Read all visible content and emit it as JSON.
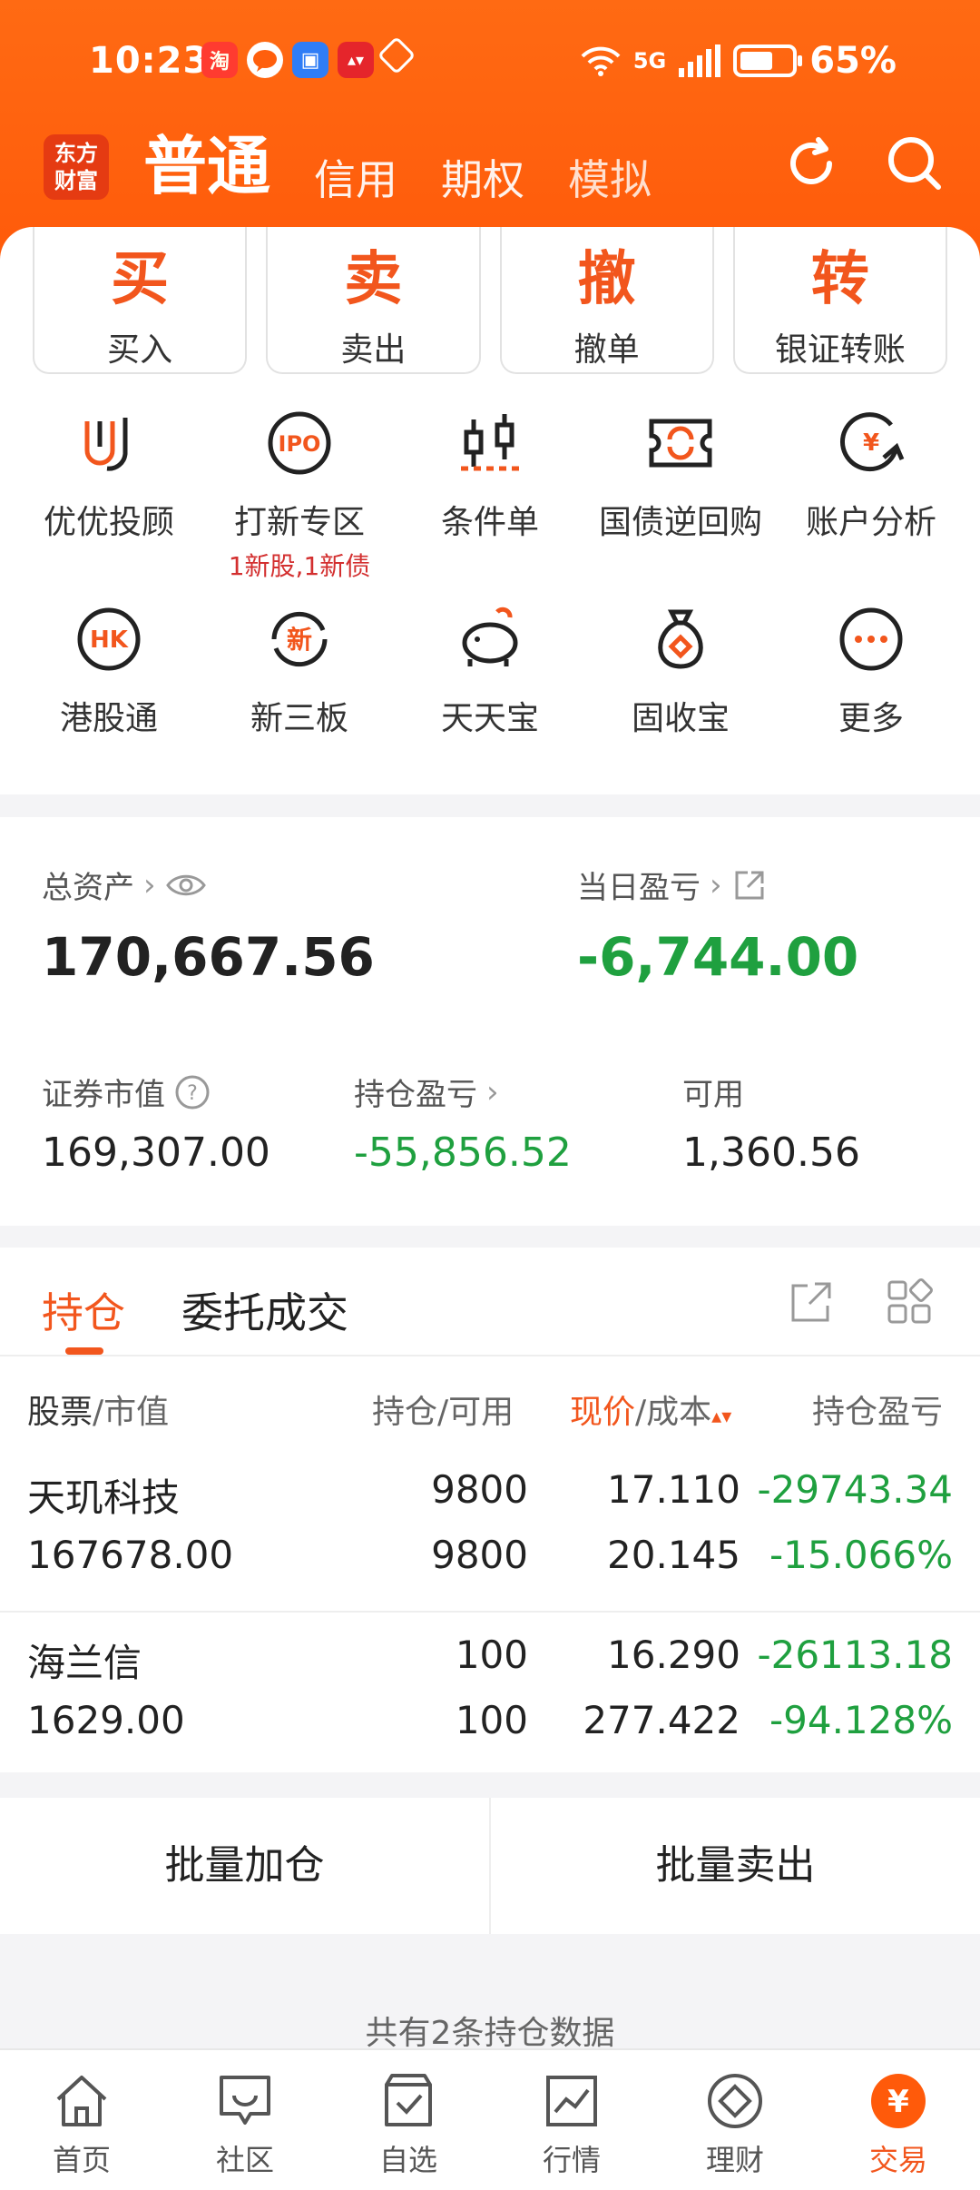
{
  "status": {
    "time": "10:23",
    "battery": "65%",
    "battery_level": 0.65,
    "network": "5G"
  },
  "nav": {
    "logo": "东方财富",
    "tabs": [
      {
        "label": "普通",
        "active": true
      },
      {
        "label": "信用"
      },
      {
        "label": "期权"
      },
      {
        "label": "模拟"
      }
    ]
  },
  "quick_actions": [
    {
      "big": "买",
      "label": "买入"
    },
    {
      "big": "卖",
      "label": "卖出"
    },
    {
      "big": "撤",
      "label": "撤单"
    },
    {
      "big": "转",
      "label": "银证转账"
    }
  ],
  "features": {
    "row1": [
      {
        "label": "优优投顾"
      },
      {
        "label": "打新专区",
        "sub": "1新股,1新债"
      },
      {
        "label": "条件单"
      },
      {
        "label": "国债逆回购"
      },
      {
        "label": "账户分析"
      }
    ],
    "row2": [
      {
        "label": "港股通"
      },
      {
        "label": "新三板"
      },
      {
        "label": "天天宝"
      },
      {
        "label": "固收宝"
      },
      {
        "label": "更多"
      }
    ]
  },
  "assets": {
    "total_label": "总资产",
    "total_value": "170,667.56",
    "daily_pnl_label": "当日盈亏",
    "daily_pnl_value": "-6,744.00",
    "market_value_label": "证券市值",
    "market_value": "169,307.00",
    "holding_pnl_label": "持仓盈亏",
    "holding_pnl": "-55,856.52",
    "available_label": "可用",
    "available": "1,360.56"
  },
  "positions": {
    "tabs": [
      "持仓",
      "委托成交"
    ],
    "headers": {
      "stock": "股票",
      "market": "/市值",
      "holding": "持仓/可用",
      "price": "现价",
      "cost": "/成本",
      "pnl": "持仓盈亏"
    },
    "rows": [
      {
        "name": "天玑科技",
        "market_value": "167678.00",
        "holding": "9800",
        "available": "9800",
        "price": "17.110",
        "cost": "20.145",
        "pnl": "-29743.34",
        "pnl_pct": "-15.066%"
      },
      {
        "name": "海兰信",
        "market_value": "1629.00",
        "holding": "100",
        "available": "100",
        "price": "16.290",
        "cost": "277.422",
        "pnl": "-26113.18",
        "pnl_pct": "-94.128%"
      }
    ]
  },
  "batch": {
    "add": "批量加仓",
    "sell": "批量卖出"
  },
  "footer_note": "共有2条持仓数据",
  "bottom_nav": [
    {
      "label": "首页"
    },
    {
      "label": "社区"
    },
    {
      "label": "自选"
    },
    {
      "label": "行情"
    },
    {
      "label": "理财"
    },
    {
      "label": "交易",
      "active": true
    }
  ],
  "colors": {
    "accent": "#f2561d",
    "negative": "#1fa03f",
    "header": "#ff5f0d"
  }
}
